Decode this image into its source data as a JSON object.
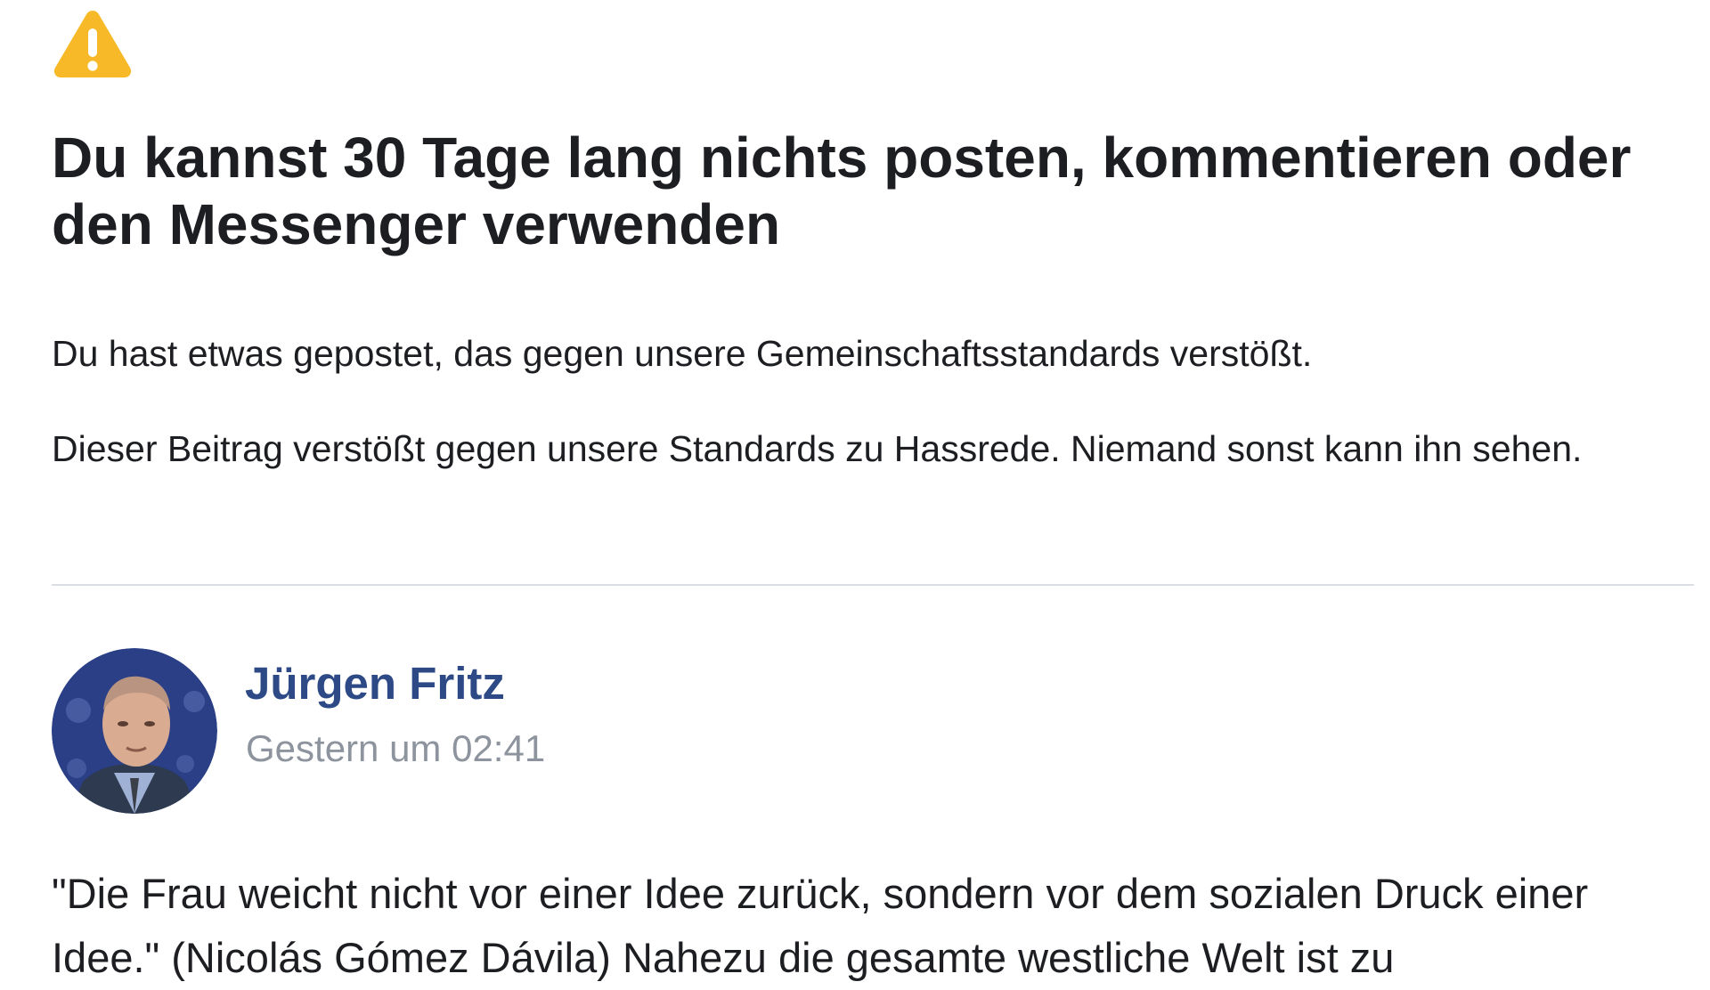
{
  "notice": {
    "icon": "warning-icon",
    "icon_color": "#f7b928",
    "title": "Du kannst 30 Tage lang nichts posten, kommentieren oder den Messenger verwenden",
    "paragraph_1": "Du hast etwas gepostet, das gegen unsere Gemeinschaftsstandards verstößt.",
    "paragraph_2": "Dieser Beitrag verstößt gegen unsere Standards zu Hassrede. Niemand sonst kann ihn sehen."
  },
  "post": {
    "author_name": "Jürgen Fritz",
    "author_color": "#2d4a86",
    "timestamp": "Gestern um 02:41",
    "text": "\"Die Frau weicht nicht vor einer Idee zurück, sondern vor dem sozialen Druck einer Idee.\" (Nicolás Gómez Dávila) Nahezu die gesamte westliche Welt ist zu"
  }
}
